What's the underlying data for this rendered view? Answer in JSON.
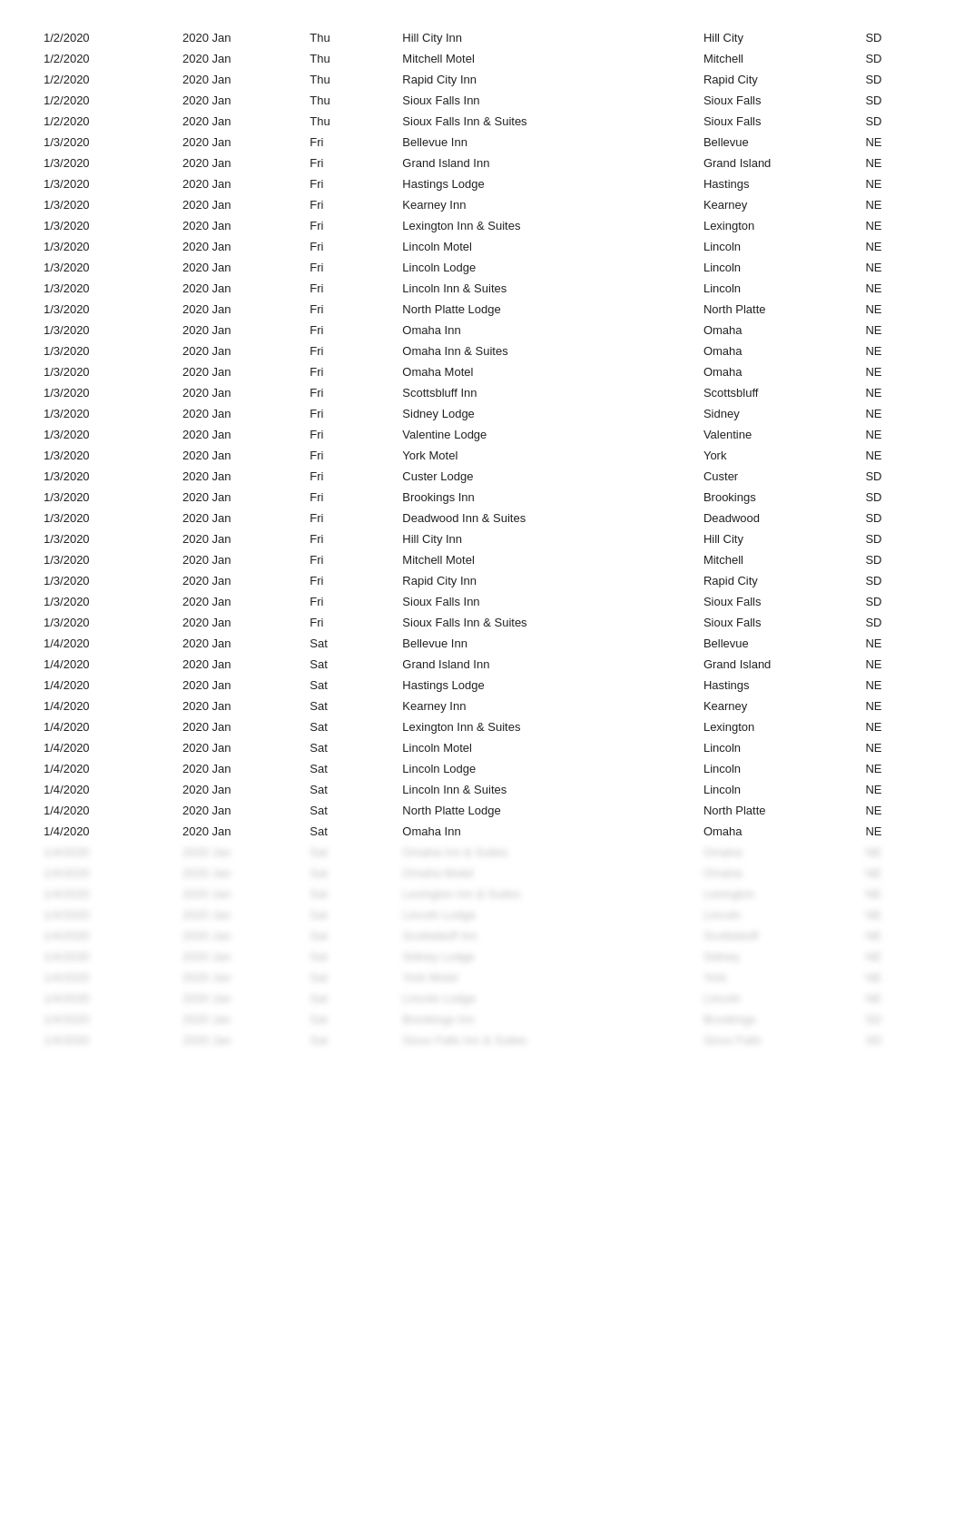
{
  "table": {
    "rows": [
      {
        "date": "1/2/2020",
        "month": "2020 Jan",
        "day": "Thu",
        "name": "Hill City Inn",
        "city": "Hill City",
        "state": "SD"
      },
      {
        "date": "1/2/2020",
        "month": "2020 Jan",
        "day": "Thu",
        "name": "Mitchell Motel",
        "city": "Mitchell",
        "state": "SD"
      },
      {
        "date": "1/2/2020",
        "month": "2020 Jan",
        "day": "Thu",
        "name": "Rapid City Inn",
        "city": "Rapid City",
        "state": "SD"
      },
      {
        "date": "1/2/2020",
        "month": "2020 Jan",
        "day": "Thu",
        "name": "Sioux Falls Inn",
        "city": "Sioux Falls",
        "state": "SD"
      },
      {
        "date": "1/2/2020",
        "month": "2020 Jan",
        "day": "Thu",
        "name": "Sioux Falls Inn & Suites",
        "city": "Sioux Falls",
        "state": "SD"
      },
      {
        "date": "1/3/2020",
        "month": "2020 Jan",
        "day": "Fri",
        "name": "Bellevue Inn",
        "city": "Bellevue",
        "state": "NE"
      },
      {
        "date": "1/3/2020",
        "month": "2020 Jan",
        "day": "Fri",
        "name": "Grand Island Inn",
        "city": "Grand Island",
        "state": "NE"
      },
      {
        "date": "1/3/2020",
        "month": "2020 Jan",
        "day": "Fri",
        "name": "Hastings Lodge",
        "city": "Hastings",
        "state": "NE"
      },
      {
        "date": "1/3/2020",
        "month": "2020 Jan",
        "day": "Fri",
        "name": "Kearney Inn",
        "city": "Kearney",
        "state": "NE"
      },
      {
        "date": "1/3/2020",
        "month": "2020 Jan",
        "day": "Fri",
        "name": "Lexington Inn & Suites",
        "city": "Lexington",
        "state": "NE"
      },
      {
        "date": "1/3/2020",
        "month": "2020 Jan",
        "day": "Fri",
        "name": "Lincoln Motel",
        "city": "Lincoln",
        "state": "NE"
      },
      {
        "date": "1/3/2020",
        "month": "2020 Jan",
        "day": "Fri",
        "name": "Lincoln Lodge",
        "city": "Lincoln",
        "state": "NE"
      },
      {
        "date": "1/3/2020",
        "month": "2020 Jan",
        "day": "Fri",
        "name": "Lincoln Inn & Suites",
        "city": "Lincoln",
        "state": "NE"
      },
      {
        "date": "1/3/2020",
        "month": "2020 Jan",
        "day": "Fri",
        "name": "North Platte Lodge",
        "city": "North Platte",
        "state": "NE"
      },
      {
        "date": "1/3/2020",
        "month": "2020 Jan",
        "day": "Fri",
        "name": "Omaha Inn",
        "city": "Omaha",
        "state": "NE"
      },
      {
        "date": "1/3/2020",
        "month": "2020 Jan",
        "day": "Fri",
        "name": "Omaha Inn & Suites",
        "city": "Omaha",
        "state": "NE"
      },
      {
        "date": "1/3/2020",
        "month": "2020 Jan",
        "day": "Fri",
        "name": "Omaha Motel",
        "city": "Omaha",
        "state": "NE"
      },
      {
        "date": "1/3/2020",
        "month": "2020 Jan",
        "day": "Fri",
        "name": "Scottsbluff Inn",
        "city": "Scottsbluff",
        "state": "NE"
      },
      {
        "date": "1/3/2020",
        "month": "2020 Jan",
        "day": "Fri",
        "name": "Sidney Lodge",
        "city": "Sidney",
        "state": "NE"
      },
      {
        "date": "1/3/2020",
        "month": "2020 Jan",
        "day": "Fri",
        "name": "Valentine Lodge",
        "city": "Valentine",
        "state": "NE"
      },
      {
        "date": "1/3/2020",
        "month": "2020 Jan",
        "day": "Fri",
        "name": "York Motel",
        "city": "York",
        "state": "NE"
      },
      {
        "date": "1/3/2020",
        "month": "2020 Jan",
        "day": "Fri",
        "name": "Custer Lodge",
        "city": "Custer",
        "state": "SD"
      },
      {
        "date": "1/3/2020",
        "month": "2020 Jan",
        "day": "Fri",
        "name": "Brookings Inn",
        "city": "Brookings",
        "state": "SD"
      },
      {
        "date": "1/3/2020",
        "month": "2020 Jan",
        "day": "Fri",
        "name": "Deadwood Inn & Suites",
        "city": "Deadwood",
        "state": "SD"
      },
      {
        "date": "1/3/2020",
        "month": "2020 Jan",
        "day": "Fri",
        "name": "Hill City Inn",
        "city": "Hill City",
        "state": "SD"
      },
      {
        "date": "1/3/2020",
        "month": "2020 Jan",
        "day": "Fri",
        "name": "Mitchell Motel",
        "city": "Mitchell",
        "state": "SD"
      },
      {
        "date": "1/3/2020",
        "month": "2020 Jan",
        "day": "Fri",
        "name": "Rapid City Inn",
        "city": "Rapid City",
        "state": "SD"
      },
      {
        "date": "1/3/2020",
        "month": "2020 Jan",
        "day": "Fri",
        "name": "Sioux Falls Inn",
        "city": "Sioux Falls",
        "state": "SD"
      },
      {
        "date": "1/3/2020",
        "month": "2020 Jan",
        "day": "Fri",
        "name": "Sioux Falls Inn & Suites",
        "city": "Sioux Falls",
        "state": "SD"
      },
      {
        "date": "1/4/2020",
        "month": "2020 Jan",
        "day": "Sat",
        "name": "Bellevue Inn",
        "city": "Bellevue",
        "state": "NE"
      },
      {
        "date": "1/4/2020",
        "month": "2020 Jan",
        "day": "Sat",
        "name": "Grand Island Inn",
        "city": "Grand Island",
        "state": "NE"
      },
      {
        "date": "1/4/2020",
        "month": "2020 Jan",
        "day": "Sat",
        "name": "Hastings Lodge",
        "city": "Hastings",
        "state": "NE"
      },
      {
        "date": "1/4/2020",
        "month": "2020 Jan",
        "day": "Sat",
        "name": "Kearney Inn",
        "city": "Kearney",
        "state": "NE"
      },
      {
        "date": "1/4/2020",
        "month": "2020 Jan",
        "day": "Sat",
        "name": "Lexington Inn & Suites",
        "city": "Lexington",
        "state": "NE"
      },
      {
        "date": "1/4/2020",
        "month": "2020 Jan",
        "day": "Sat",
        "name": "Lincoln Motel",
        "city": "Lincoln",
        "state": "NE"
      },
      {
        "date": "1/4/2020",
        "month": "2020 Jan",
        "day": "Sat",
        "name": "Lincoln Lodge",
        "city": "Lincoln",
        "state": "NE"
      },
      {
        "date": "1/4/2020",
        "month": "2020 Jan",
        "day": "Sat",
        "name": "Lincoln Inn & Suites",
        "city": "Lincoln",
        "state": "NE"
      },
      {
        "date": "1/4/2020",
        "month": "2020 Jan",
        "day": "Sat",
        "name": "North Platte Lodge",
        "city": "North Platte",
        "state": "NE"
      },
      {
        "date": "1/4/2020",
        "month": "2020 Jan",
        "day": "Sat",
        "name": "Omaha Inn",
        "city": "Omaha",
        "state": "NE"
      }
    ],
    "blurred_rows": [
      {
        "date": "1/4/2020",
        "month": "2020 Jan",
        "day": "Sat",
        "name": "Omaha Inn & Suites",
        "city": "Omaha",
        "state": "NE"
      },
      {
        "date": "1/4/2020",
        "month": "2020 Jan",
        "day": "Sat",
        "name": "Omaha Motel",
        "city": "Omaha",
        "state": "NE"
      },
      {
        "date": "1/4/2020",
        "month": "2020 Jan",
        "day": "Sat",
        "name": "Lexington Inn & Suites",
        "city": "Lexington",
        "state": "NE"
      },
      {
        "date": "1/4/2020",
        "month": "2020 Jan",
        "day": "Sat",
        "name": "Lincoln Lodge",
        "city": "Lincoln",
        "state": "NE"
      },
      {
        "date": "1/4/2020",
        "month": "2020 Jan",
        "day": "Sat",
        "name": "Scottsbluff Inn",
        "city": "Scottsbluff",
        "state": "NE"
      },
      {
        "date": "1/4/2020",
        "month": "2020 Jan",
        "day": "Sat",
        "name": "Sidney Lodge",
        "city": "Sidney",
        "state": "NE"
      },
      {
        "date": "1/4/2020",
        "month": "2020 Jan",
        "day": "Sat",
        "name": "York Motel",
        "city": "York",
        "state": "NE"
      },
      {
        "date": "1/4/2020",
        "month": "2020 Jan",
        "day": "Sat",
        "name": "Lincoln Lodge",
        "city": "Lincoln",
        "state": "NE"
      },
      {
        "date": "1/4/2020",
        "month": "2020 Jan",
        "day": "Sat",
        "name": "Brookings Inn",
        "city": "Brookings",
        "state": "SD"
      },
      {
        "date": "1/4/2020",
        "month": "2020 Jan",
        "day": "Sat",
        "name": "Sioux Falls Inn & Suites",
        "city": "Sioux Falls",
        "state": "SD"
      }
    ]
  }
}
